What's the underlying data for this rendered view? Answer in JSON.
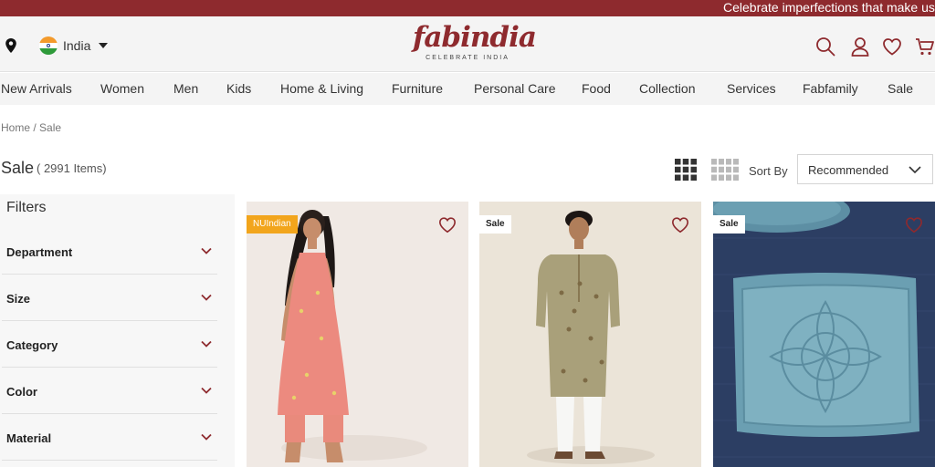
{
  "announcement": "Celebrate imperfections that make us u",
  "header": {
    "country": "India",
    "logo": {
      "word": "fabindia",
      "tagline": "CELEBRATE INDIA"
    }
  },
  "nav": [
    "New Arrivals",
    "Women",
    "Men",
    "Kids",
    "Home & Living",
    "Furniture",
    "Personal Care",
    "Food",
    "Collection",
    "Services",
    "Fabfamily",
    "Sale"
  ],
  "breadcrumb": {
    "home": "Home",
    "sep": " / ",
    "current": "Sale"
  },
  "listing": {
    "title": "Sale",
    "count": "( 2991 Items)"
  },
  "sort": {
    "label": "Sort By",
    "value": "Recommended"
  },
  "filters": {
    "title": "Filters",
    "items": [
      "Department",
      "Size",
      "Category",
      "Color",
      "Material"
    ]
  },
  "products": [
    {
      "badge": "NUIndian",
      "badge_style": "nu",
      "image": "woman in pink kurta and pants"
    },
    {
      "badge": "Sale",
      "badge_style": "sale",
      "image": "man in printed kurta and white pyjama"
    },
    {
      "badge": "Sale",
      "badge_style": "sale",
      "image": "blue ceramic square plate"
    }
  ],
  "colors": {
    "brand": "#8e2a2e",
    "nav_bg": "#f4f4f4",
    "badge_nu": "#f2a51c"
  },
  "icons": [
    "location-pin-icon",
    "india-flag-icon",
    "search-icon",
    "user-icon",
    "heart-icon",
    "cart-icon",
    "grid-3-icon",
    "grid-4-icon",
    "chevron-down-icon"
  ]
}
